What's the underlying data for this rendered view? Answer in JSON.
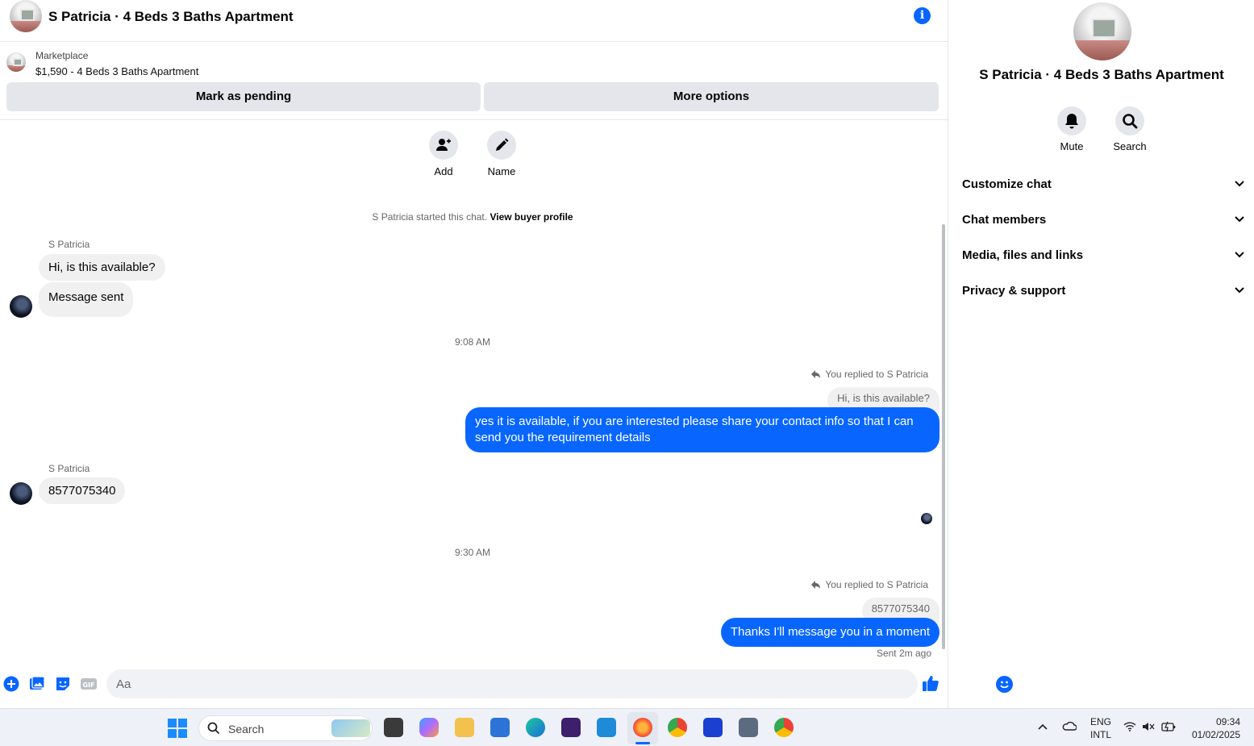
{
  "header": {
    "title": "S Patricia · 4 Beds 3 Baths Apartment",
    "info_icon": "info-icon"
  },
  "listing": {
    "category": "Marketplace",
    "price_title": "$1,590 - 4 Beds 3 Baths Apartment",
    "mark_pending": "Mark as pending",
    "more_options": "More options"
  },
  "actions": {
    "add": "Add",
    "name": "Name"
  },
  "conversation": {
    "started_text": "S Patricia started this chat.",
    "view_buyer": "View buyer profile",
    "sender_name": "S Patricia",
    "msg1": "Hi, is this available?",
    "msg2": "Message sent",
    "time1": "9:08 AM",
    "reply_label": "You replied to S Patricia",
    "reply1_quote": "Hi, is this available?",
    "reply1_text": "yes it is available, if you are interested please share your contact info so that I can send you the requirement details",
    "msg3": "8577075340",
    "time2": "9:30 AM",
    "reply2_quote": "8577075340",
    "reply2_text": "Thanks I'll message you in a moment",
    "sent_status": "Sent 2m ago"
  },
  "composer": {
    "placeholder": "Aa"
  },
  "sidebar": {
    "title": "S Patricia · 4 Beds 3 Baths Apartment",
    "mute": "Mute",
    "search": "Search",
    "sections": [
      "Customize chat",
      "Chat members",
      "Media, files and links",
      "Privacy & support"
    ]
  },
  "taskbar": {
    "search": "Search",
    "lang1": "ENG",
    "lang2": "INTL",
    "time": "09:34",
    "date": "01/02/2025"
  },
  "colors": {
    "accent": "#0866ff",
    "bubble_in": "#f0f0f0",
    "button_gray": "#e4e6eb"
  }
}
